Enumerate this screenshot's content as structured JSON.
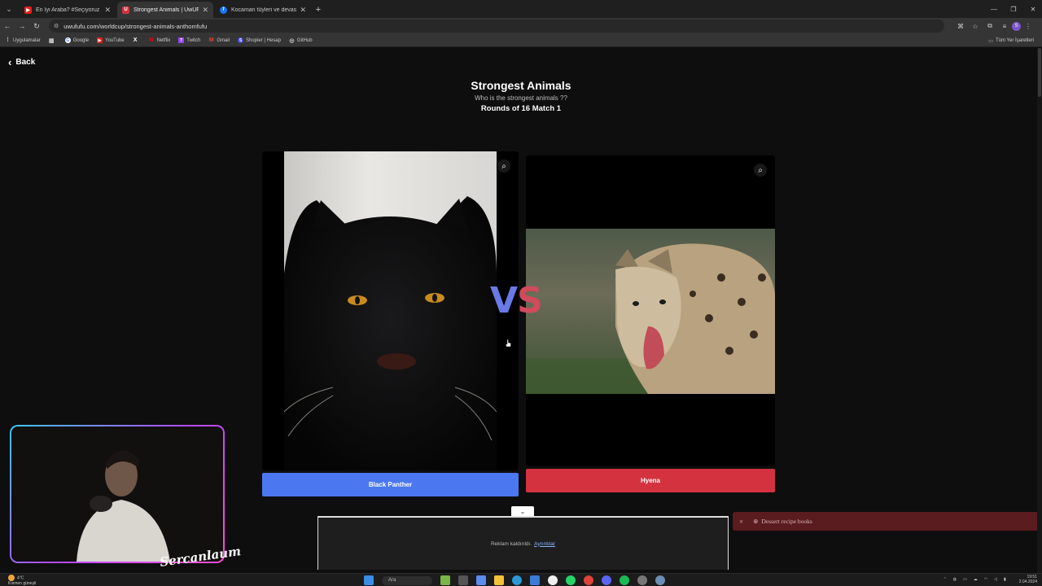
{
  "browser": {
    "tabs": [
      {
        "title": "En İyi Araba? #Seçiyoruz - YouTube",
        "favicon_color": "#e62117",
        "favicon_glyph": "▶",
        "active": false
      },
      {
        "title": "Strongest Animals | UwUFUFU",
        "favicon_color": "#d4323f",
        "favicon_glyph": "U",
        "active": true
      },
      {
        "title": "Kocaman tüyleri ve devasa hali...",
        "favicon_color": "#1877f2",
        "favicon_glyph": "f",
        "active": false
      }
    ],
    "url": "uwufufu.com/worldcup/strongest-animals-anthomfufu",
    "bookmarks": [
      {
        "label": "Uygulamalar",
        "icon": "apps-icon",
        "color": "#888888"
      },
      {
        "label": "Google",
        "icon": "google-icon",
        "color": "#4285f4"
      },
      {
        "label": "YouTube",
        "icon": "youtube-icon",
        "color": "#e62117"
      },
      {
        "label": "",
        "icon": "x-icon",
        "color": "#000000"
      },
      {
        "label": "Netflix",
        "icon": "netflix-icon",
        "color": "#e50914"
      },
      {
        "label": "Twitch",
        "icon": "twitch-icon",
        "color": "#9146ff"
      },
      {
        "label": "Gmail",
        "icon": "gmail-icon",
        "color": "#ea4335"
      },
      {
        "label": "Shopier | Hesap",
        "icon": "shopier-icon",
        "color": "#4a4ae0"
      },
      {
        "label": "GitHub",
        "icon": "github-icon",
        "color": "#333333"
      }
    ],
    "bookmarks_right": "Tüm Yer İşaretleri"
  },
  "page": {
    "back_label": "Back",
    "title": "Strongest Animals",
    "subtitle": "Who is the strongest animals ??",
    "round": "Rounds of 16 Match 1",
    "vs_v": "V",
    "vs_s": "S",
    "left_choice": "Black Panther",
    "right_choice": "Hyena",
    "ad_text": "Reklam kaldırıldı.",
    "ad_link": "Ayrıntılar",
    "toast_text": "Dessert recipe books"
  },
  "overlay": {
    "brand": "Sercanlaum"
  },
  "taskbar": {
    "weather_temp": "4°C",
    "weather_desc": "Kısmen güneşli",
    "search_placeholder": "Ara",
    "time": "19:51",
    "date": "2.04.2024"
  },
  "colors": {
    "left_button": "#4b78f0",
    "right_button": "#d4323f",
    "vs_v": "#6a79e6",
    "vs_s": "#d24a5c"
  }
}
